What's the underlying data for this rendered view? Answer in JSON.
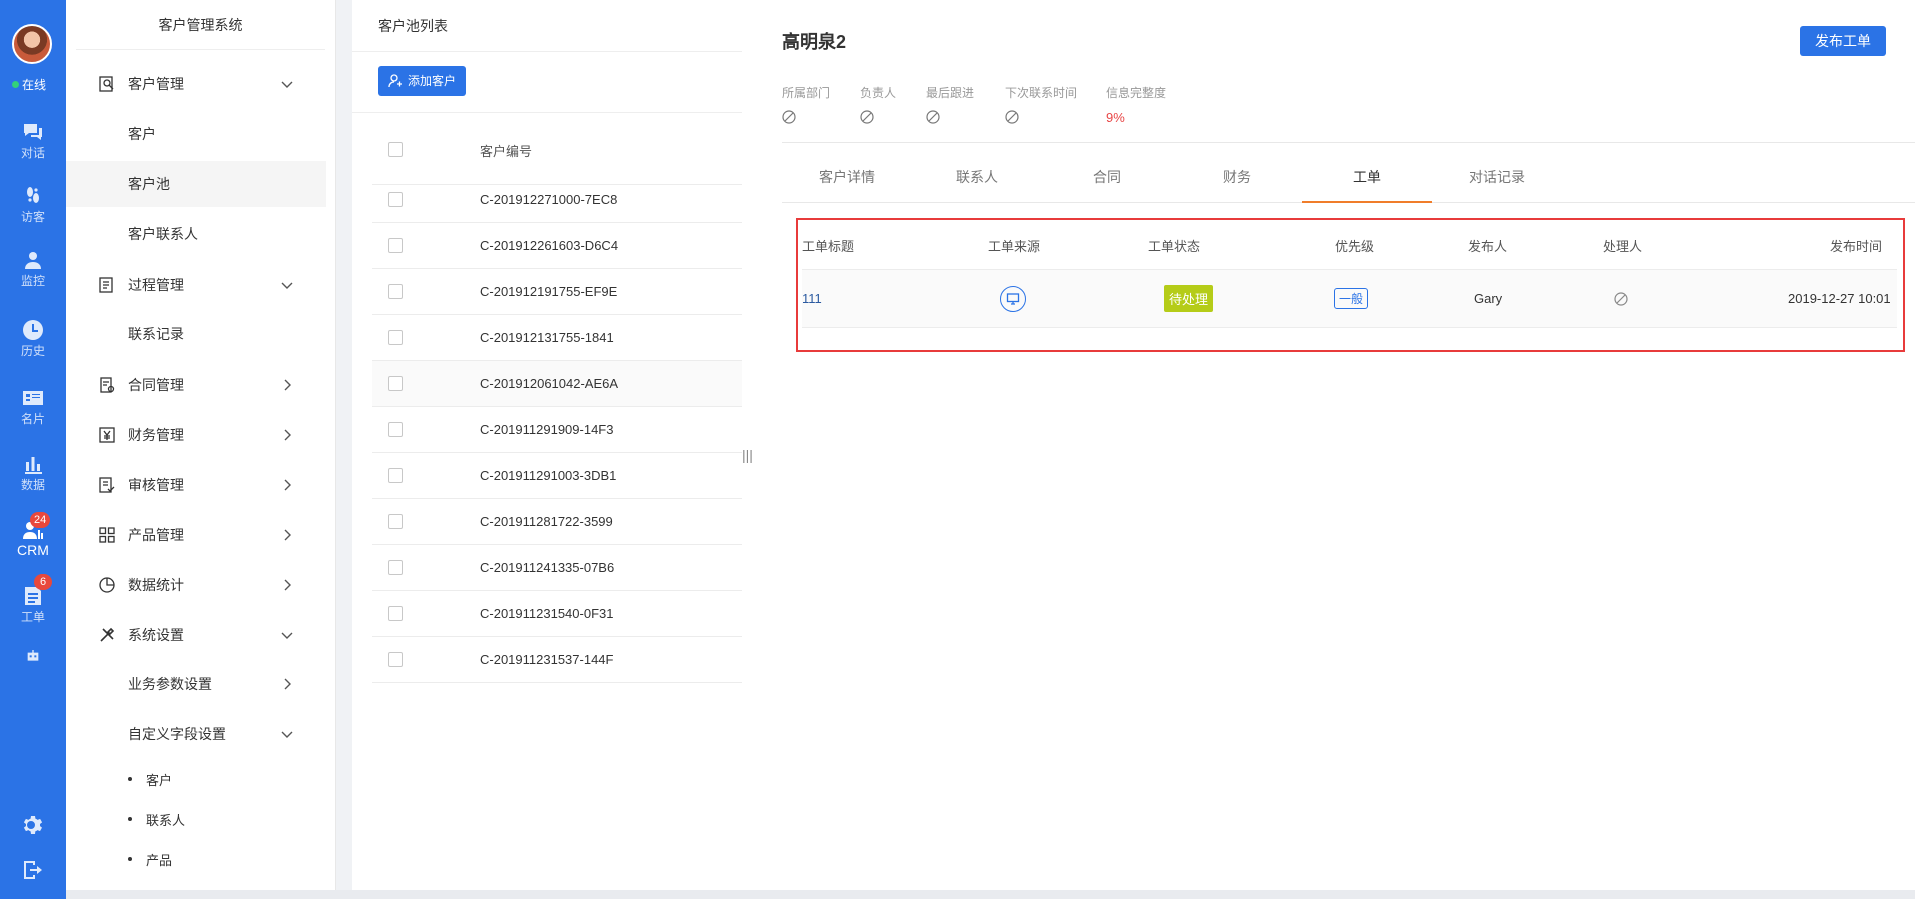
{
  "rail": {
    "status": "在线",
    "items": [
      {
        "label": "对话",
        "icon": "chat-icon"
      },
      {
        "label": "访客",
        "icon": "footprint-icon"
      },
      {
        "label": "监控",
        "icon": "monitor-user-icon"
      },
      {
        "label": "历史",
        "icon": "clock-icon"
      },
      {
        "label": "名片",
        "icon": "id-card-icon"
      },
      {
        "label": "数据",
        "icon": "bar-chart-icon"
      },
      {
        "label": "CRM",
        "icon": "crm-icon",
        "badge": "24",
        "active": true
      },
      {
        "label": "工单",
        "icon": "ticket-icon",
        "badge": "6"
      },
      {
        "label": "",
        "icon": "robot-icon"
      }
    ],
    "bottom": [
      "gear-icon",
      "logout-icon"
    ]
  },
  "menu": {
    "title": "客户管理系统",
    "customer_mgmt": "客户管理",
    "customer": "客户",
    "customer_pool": "客户池",
    "customer_contact": "客户联系人",
    "process_mgmt": "过程管理",
    "contact_record": "联系记录",
    "contract_mgmt": "合同管理",
    "finance_mgmt": "财务管理",
    "audit_mgmt": "审核管理",
    "product_mgmt": "产品管理",
    "data_stats": "数据统计",
    "system_settings": "系统设置",
    "business_params": "业务参数设置",
    "custom_fields": "自定义字段设置",
    "field_customer": "客户",
    "field_contact": "联系人",
    "field_product": "产品"
  },
  "list": {
    "title": "客户池列表",
    "add_button": "添加客户",
    "column_code": "客户编号",
    "rows": [
      "C-201912271000-7EC8",
      "C-201912261603-D6C4",
      "C-201912191755-EF9E",
      "C-201912131755-1841",
      "C-201912061042-AE6A",
      "C-201911291909-14F3",
      "C-201911291003-3DB1",
      "C-201911281722-3599",
      "C-201911241335-07B6",
      "C-201911231540-0F31",
      "C-201911231537-144F"
    ]
  },
  "detail": {
    "name": "高明泉2",
    "publish_button": "发布工单",
    "info": {
      "department_label": "所属部门",
      "owner_label": "负责人",
      "last_follow_label": "最后跟进",
      "next_contact_label": "下次联系时间",
      "completeness_label": "信息完整度",
      "completeness_value": "9%"
    },
    "tabs": [
      "客户详情",
      "联系人",
      "合同",
      "财务",
      "工单",
      "对话记录"
    ],
    "active_tab": "工单",
    "ticket_table": {
      "headers": [
        "工单标题",
        "工单来源",
        "工单状态",
        "优先级",
        "发布人",
        "处理人",
        "发布时间"
      ],
      "rows": [
        {
          "title": "111",
          "source_icon": "desktop-icon",
          "status": "待处理",
          "priority": "一般",
          "publisher": "Gary",
          "handler_icon": "ban-icon",
          "time": "2019-12-27 10:01"
        }
      ]
    }
  },
  "colors": {
    "primary": "#2b73e6",
    "status_pending": "#b5cc18",
    "highlight_outline": "#e83b3b",
    "active_tab_underline": "#f07d2a",
    "completeness_red": "#e84545"
  }
}
